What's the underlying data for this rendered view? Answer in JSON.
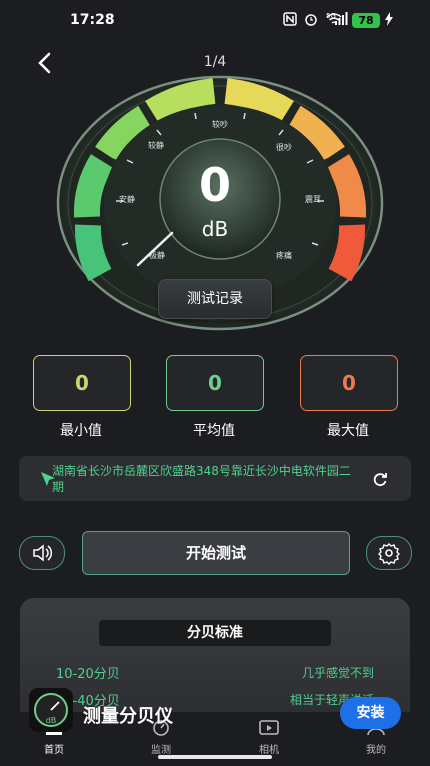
{
  "status_bar": {
    "time": "17:28",
    "battery": "78",
    "network": "5G"
  },
  "header": {
    "pager": "1/4"
  },
  "gauge": {
    "value": "0",
    "unit": "dB",
    "labels": [
      "较静",
      "安静",
      "较吵",
      "很吵",
      "震耳",
      "疼痛",
      "极静"
    ]
  },
  "record_button": "测试记录",
  "stats": [
    {
      "value": "0",
      "label": "最小值",
      "color": "#c7d66e"
    },
    {
      "value": "0",
      "label": "平均值",
      "color": "#6fcf8a"
    },
    {
      "value": "0",
      "label": "最大值",
      "color": "#ee7a4e"
    }
  ],
  "location": {
    "text": "湖南省长沙市岳麓区欣盛路348号靠近长沙中电软件园二期"
  },
  "controls": {
    "start": "开始测试"
  },
  "standards": {
    "title": "分贝标准",
    "rows": [
      {
        "range": "10-20分贝",
        "desc": "几乎感觉不到"
      },
      {
        "range": "20-40分贝",
        "desc": "相当于轻声说话"
      }
    ]
  },
  "ad": {
    "title": "测量分贝仪",
    "install": "安装",
    "icon_text": "dB"
  },
  "tabs": [
    {
      "label": "首页"
    },
    {
      "label": "监测"
    },
    {
      "label": "相机"
    },
    {
      "label": "我的"
    }
  ],
  "colors": {
    "accent_green": "#4fd18f",
    "ad_blue": "#1e6fe8"
  }
}
